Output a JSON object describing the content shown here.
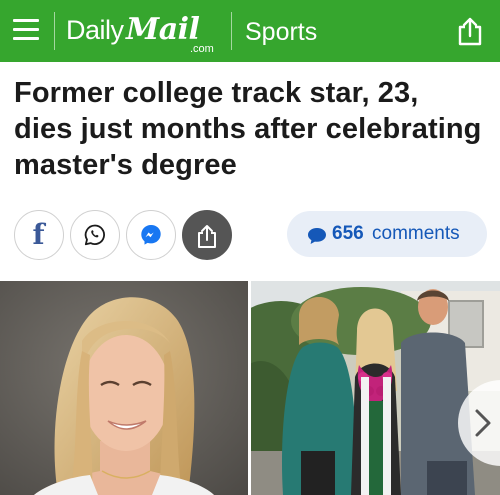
{
  "header": {
    "logo": {
      "word1": "Daily",
      "word2": "Mail",
      "suffix": ".com"
    },
    "section": "Sports",
    "icons": {
      "menu": "hamburger-menu-icon",
      "share": "share-icon"
    },
    "colors": {
      "bar": "#36a62e",
      "text": "#ffffff"
    }
  },
  "article": {
    "headline": "Former college track star, 23, dies just months after celebrating master's degree"
  },
  "share_bar": {
    "buttons": [
      {
        "name": "facebook",
        "icon": "facebook-icon"
      },
      {
        "name": "whatsapp",
        "icon": "whatsapp-icon"
      },
      {
        "name": "messenger",
        "icon": "messenger-icon"
      },
      {
        "name": "share",
        "icon": "share-icon"
      }
    ],
    "comments": {
      "count": "656",
      "label": "comments",
      "icon": "comment-bubble-icon",
      "color": "#1558b8"
    }
  },
  "gallery": {
    "images": [
      {
        "name": "portrait-photo",
        "description": "Smiling young woman with long blonde hair"
      },
      {
        "name": "graduation-photo",
        "description": "Graduate with lei and stole between two parents"
      }
    ],
    "next_icon": "chevron-right-icon"
  }
}
